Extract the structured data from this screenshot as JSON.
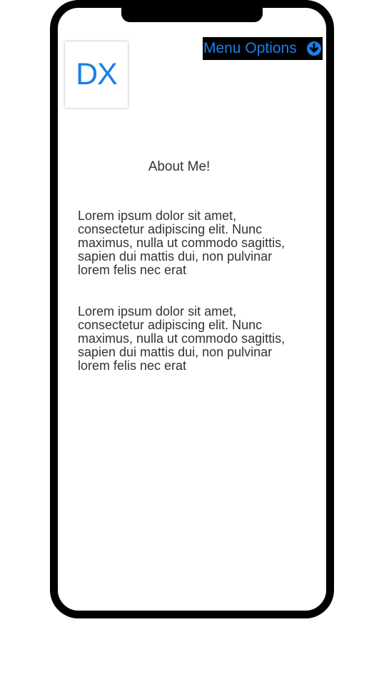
{
  "logo": {
    "text": "DX",
    "color": "#1a7fe6"
  },
  "menu": {
    "label": "Menu Options",
    "icon": "chevron-down-circle-icon",
    "text_color": "#1a7fe6",
    "background": "#000000"
  },
  "about": {
    "title": "About Me!",
    "paragraphs": [
      "Lorem ipsum dolor sit amet, consectetur adipiscing elit. Nunc maximus, nulla ut commodo sagittis, sapien dui mattis dui, non pulvinar lorem felis nec erat",
      "Lorem ipsum dolor sit amet, consectetur adipiscing elit. Nunc maximus, nulla ut commodo sagittis, sapien dui mattis dui, non pulvinar lorem felis nec erat"
    ]
  }
}
